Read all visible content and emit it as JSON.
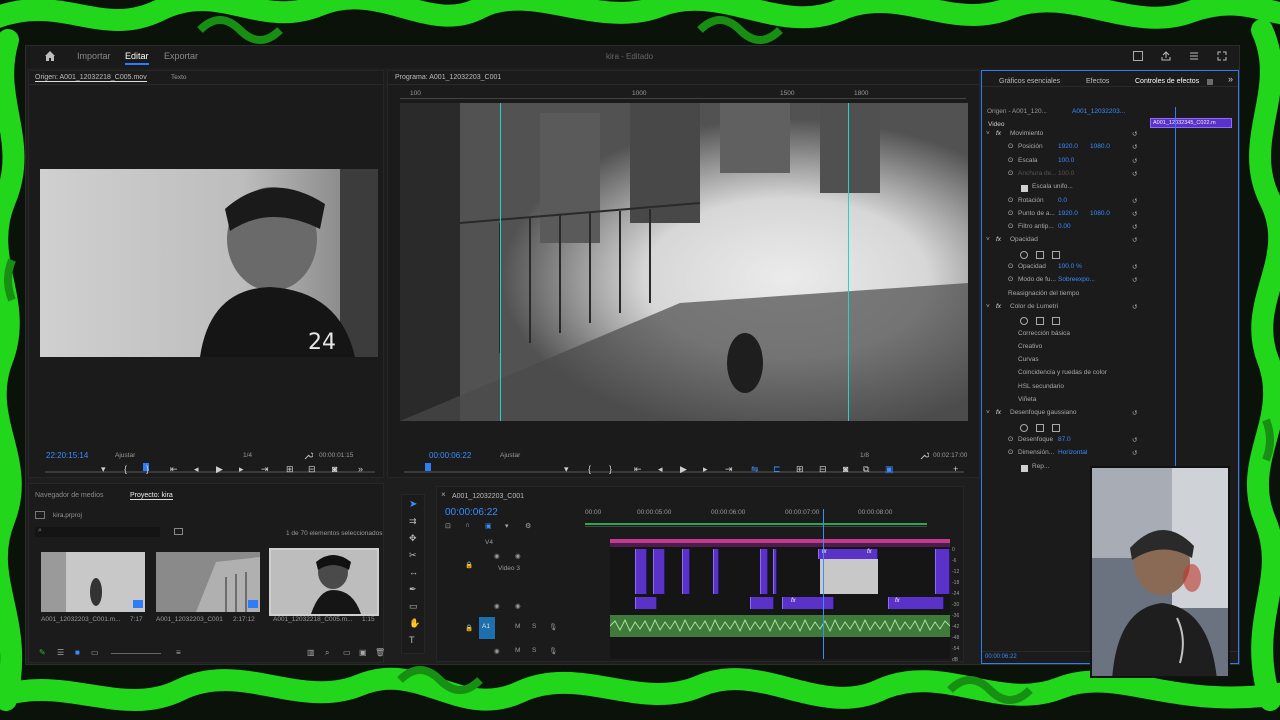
{
  "app": {
    "nav": [
      "Importar",
      "Editar",
      "Exportar"
    ],
    "active_nav": "Editar",
    "project_title": "kira - Editado"
  },
  "source_monitor": {
    "tab_label": "Origen: A001_12032218_C005.mov",
    "tab_text": "Texto",
    "timecode": "22:20:15:14",
    "fit": "Ajustar",
    "resolution": "1/4",
    "duration": "00:00:01:15"
  },
  "program_monitor": {
    "tab_label": "Programa: A001_12032203_C001",
    "timecode": "00:00:06:22",
    "fit": "Ajustar",
    "resolution": "1/8",
    "duration": "00:02:17:00",
    "ruler": [
      "100",
      "1000",
      "1500",
      "1800"
    ]
  },
  "effects_panel": {
    "tabs": [
      "Gráficos esenciales",
      "Efectos",
      "Controles de efectos"
    ],
    "active_tab": "Controles de efectos",
    "source": "Origen - A001_120...",
    "clip": "A001_12032203...",
    "mini_clip": "A001_12032345_C022.m",
    "mini_time": "00:00:06:22",
    "section_video": "Video",
    "rows": [
      {
        "label": "Movimiento",
        "indent": 1,
        "fx": true
      },
      {
        "label": "Posición",
        "v1": "1920.0",
        "v2": "1080.0",
        "indent": 2
      },
      {
        "label": "Escala",
        "v1": "100.0",
        "indent": 2
      },
      {
        "label": "Anchura de...",
        "v1": "100.0",
        "indent": 2,
        "dim": true
      },
      {
        "label": "Escala unifo...",
        "indent": 3,
        "check": true
      },
      {
        "label": "Rotación",
        "v1": "0.0",
        "indent": 2
      },
      {
        "label": "Punto de a...",
        "v1": "1920.0",
        "v2": "1080.0",
        "indent": 2
      },
      {
        "label": "Filtro antip...",
        "v1": "0.00",
        "indent": 2
      },
      {
        "label": "Opacidad",
        "indent": 1,
        "fx": true
      },
      {
        "label": "",
        "indent": 2,
        "masks": true
      },
      {
        "label": "Opacidad",
        "v1": "100.0 %",
        "indent": 2
      },
      {
        "label": "Modo de fu...",
        "v1": "Sobreexpo...",
        "indent": 2
      },
      {
        "label": "Reasignación del tiempo",
        "indent": 1
      },
      {
        "label": "Color de Lumetri",
        "indent": 1,
        "fx": true
      },
      {
        "label": "",
        "indent": 2,
        "masks": true
      },
      {
        "label": "Corrección básica",
        "indent": 2
      },
      {
        "label": "Creativo",
        "indent": 2
      },
      {
        "label": "Curvas",
        "indent": 2
      },
      {
        "label": "Coincidencia y ruedas de color",
        "indent": 2
      },
      {
        "label": "HSL secundario",
        "indent": 2
      },
      {
        "label": "Viñeta",
        "indent": 2
      },
      {
        "label": "Desenfoque gaussiano",
        "indent": 1,
        "fx": true
      },
      {
        "label": "",
        "indent": 2,
        "masks": true
      },
      {
        "label": "Desenfoque",
        "v1": "87.0",
        "indent": 2
      },
      {
        "label": "Dimensión...",
        "v1": "Horizontal",
        "indent": 2
      },
      {
        "label": "Rep...",
        "indent": 3,
        "check": true
      }
    ],
    "footer_time": "00:00:06:22"
  },
  "project_panel": {
    "tabs": [
      "Navegador de medios",
      "Proyecto: kira"
    ],
    "active_tab": "Proyecto: kira",
    "file": "kira.prproj",
    "selection": "1 de 70 elementos seleccionados",
    "items": [
      {
        "name": "A001_12032203_C001.m...",
        "dur": "7:17"
      },
      {
        "name": "A001_12032203_C001",
        "dur": "2:17:12"
      },
      {
        "name": "A001_12032218_C005.m...",
        "dur": "1:15"
      }
    ]
  },
  "timeline": {
    "tab_label": "A001_12032203_C001",
    "timecode": "00:00:06:22",
    "ruler": [
      "00:00",
      "00:00:05:00",
      "00:00:06:00",
      "00:00:07:00",
      "00:00:08:00"
    ],
    "video_track": "Video 3",
    "audio_track": "A1",
    "meter_labels": [
      "0",
      "-6",
      "-12",
      "-18",
      "-24",
      "-30",
      "-36",
      "-42",
      "-48",
      "-54",
      "dB"
    ]
  },
  "colors": {
    "accent": "#2e7cf6",
    "clip_video": "#5a32c8",
    "clip_audio": "#3f7a3a",
    "background_green": "#20d11a"
  }
}
